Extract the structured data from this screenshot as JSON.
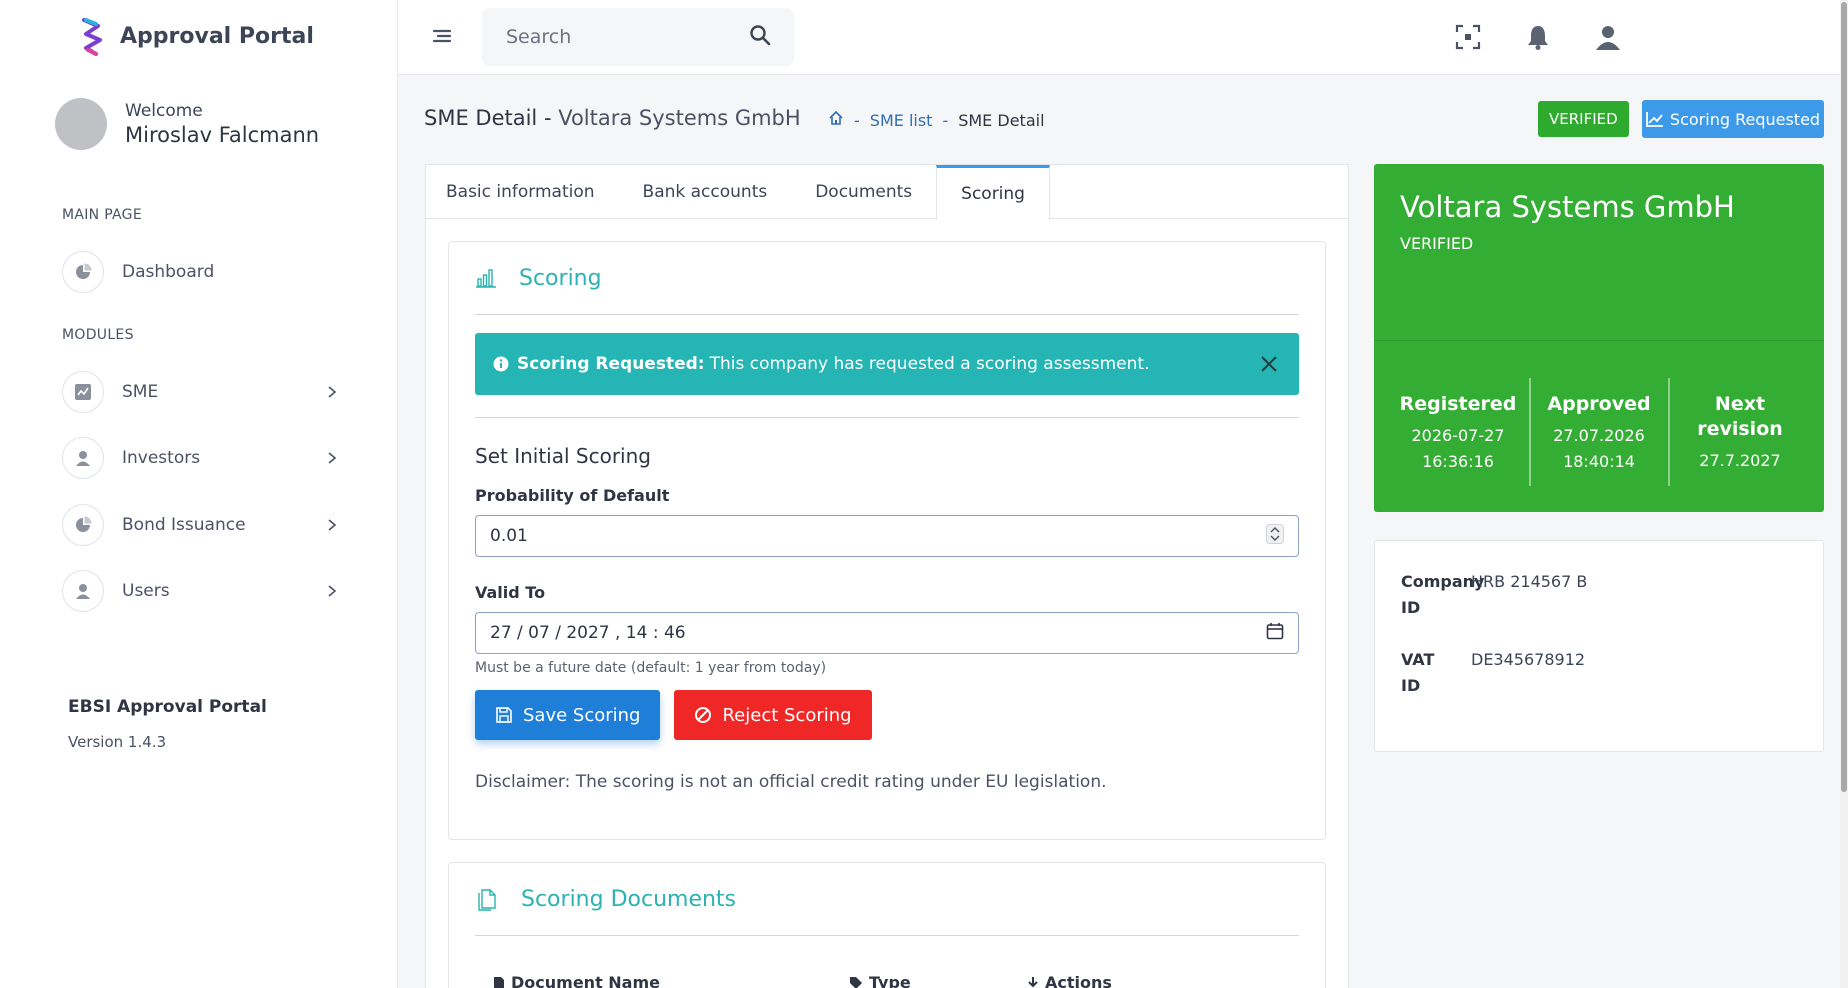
{
  "app": {
    "title": "Approval Portal"
  },
  "user": {
    "welcome": "Welcome",
    "name": "Miroslav Falcmann"
  },
  "sidebar": {
    "main_title": "MAIN PAGE",
    "modules_title": "MODULES",
    "items": [
      {
        "label": "Dashboard",
        "icon": "pie-chart-icon"
      },
      {
        "label": "SME",
        "icon": "chart-box-icon"
      },
      {
        "label": "Investors",
        "icon": "user-icon"
      },
      {
        "label": "Bond Issuance",
        "icon": "pie-chart-icon"
      },
      {
        "label": "Users",
        "icon": "user-icon"
      }
    ],
    "footer_title": "EBSI Approval Portal",
    "footer_version": "Version 1.4.3"
  },
  "search": {
    "placeholder": "Search"
  },
  "page": {
    "title": "SME Detail",
    "title_dash": " - ",
    "company": "Voltara Systems GmbH",
    "breadcrumb": {
      "sep": "-",
      "list": "SME list",
      "current": "SME Detail"
    },
    "status_badge": "VERIFIED",
    "scoring_requested_btn": "Scoring Requested"
  },
  "tabs": [
    "Basic information",
    "Bank accounts",
    "Documents",
    "Scoring"
  ],
  "scoring": {
    "title": "Scoring",
    "alert_bold": "Scoring Requested:",
    "alert_text": "This company has requested a scoring assessment.",
    "set_initial": "Set Initial Scoring",
    "pd_label": "Probability of Default",
    "pd_value": "0.01",
    "valid_label": "Valid To",
    "valid_value": "27 / 07 / 2027 ,  14 : 46",
    "valid_hint": "Must be a future date (default: 1 year from today)",
    "save_btn": "Save Scoring",
    "reject_btn": "Reject Scoring",
    "disclaimer": "Disclaimer: The scoring is not an official credit rating under EU legislation."
  },
  "documents": {
    "title": "Scoring Documents",
    "columns": [
      "Document Name",
      "Type",
      "Actions"
    ]
  },
  "company_card": {
    "name": "Voltara Systems GmbH",
    "status": "VERIFIED",
    "registered_label": "Registered",
    "registered_date": "2026-07-27",
    "registered_time": "16:36:16",
    "approved_label": "Approved",
    "approved_date": "27.07.2026",
    "approved_time": "18:40:14",
    "next_label_1": "Next",
    "next_label_2": "revision",
    "next_value": "27.7.2027"
  },
  "company_info": {
    "company_id_label_1": "Company",
    "company_id_label_2": "ID",
    "company_id": "HRB 214567 B",
    "vat_label_1": "VAT",
    "vat_label_2": "ID",
    "vat_id": "DE345678912"
  },
  "colors": {
    "accent": "#3d9ae8",
    "teal": "#24b5b4",
    "green": "#34ad34",
    "red": "#f02727"
  }
}
